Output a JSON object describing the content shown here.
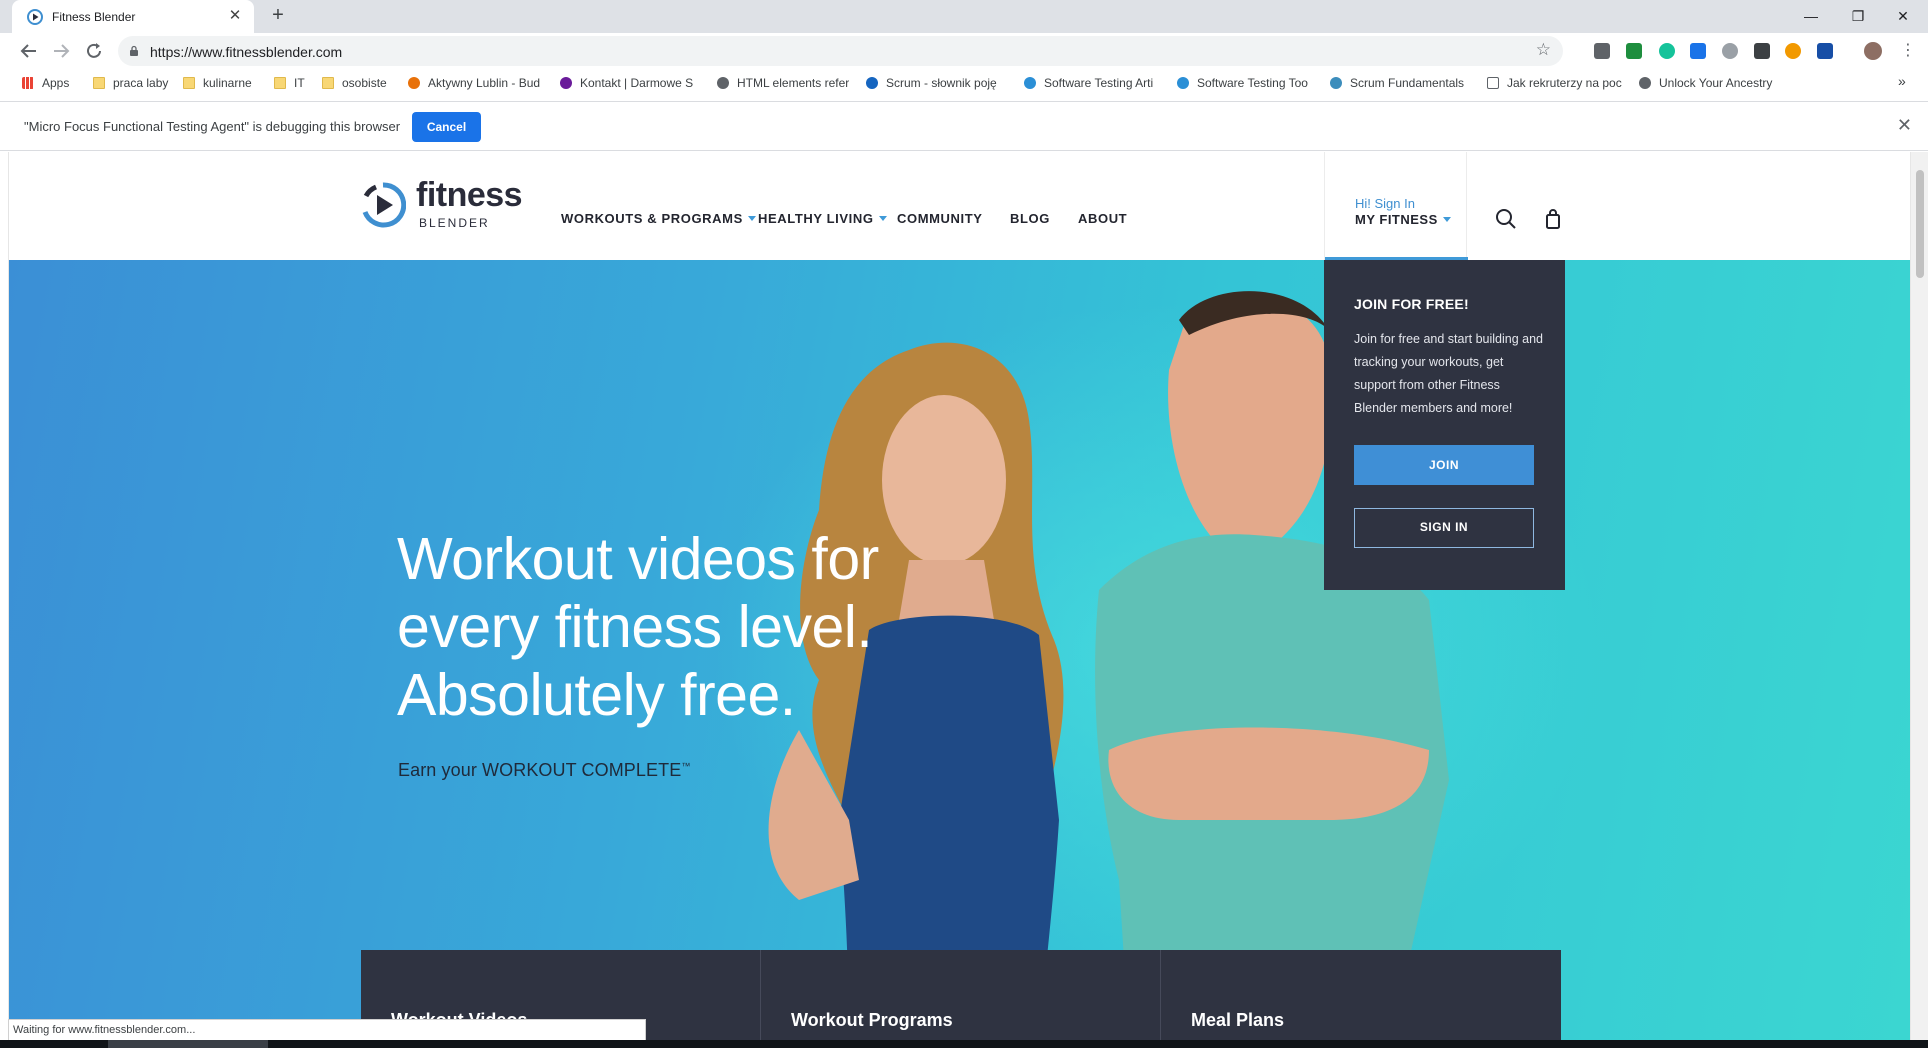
{
  "browser": {
    "tab": {
      "title": "Fitness Blender",
      "close": "✕"
    },
    "new_tab": "+",
    "window_controls": {
      "minimize": "—",
      "restore": "❐",
      "close": "✕"
    },
    "url": "https://www.fitnessblender.com",
    "bookmarks": [
      {
        "label": "Apps",
        "icon": "apps-grid-icon"
      },
      {
        "label": "praca laby",
        "icon": "folder-icon"
      },
      {
        "label": "kulinarne",
        "icon": "folder-icon"
      },
      {
        "label": "IT",
        "icon": "folder-icon"
      },
      {
        "label": "osobiste",
        "icon": "folder-icon"
      },
      {
        "label": "Aktywny Lublin - Bud",
        "icon": "site-icon"
      },
      {
        "label": "Kontakt | Darmowe S",
        "icon": "site-icon"
      },
      {
        "label": "HTML elements refer",
        "icon": "site-icon"
      },
      {
        "label": "Scrum - słownik poję",
        "icon": "site-icon"
      },
      {
        "label": "Software Testing Arti",
        "icon": "site-icon"
      },
      {
        "label": "Software Testing Too",
        "icon": "site-icon"
      },
      {
        "label": "Scrum Fundamentals",
        "icon": "site-icon"
      },
      {
        "label": "Jak rekruterzy na poc",
        "icon": "page-icon"
      },
      {
        "label": "Unlock Your Ancestry",
        "icon": "site-icon"
      }
    ],
    "bookmarks_overflow": "»",
    "infobar": {
      "message": "\"Micro Focus Functional Testing Agent\" is debugging this browser",
      "cancel_label": "Cancel",
      "close": "✕"
    },
    "status_text": "Waiting for www.fitnessblender.com...",
    "colors": {
      "tabstrip": "#dee1e6",
      "accent": "#1a73e8"
    }
  },
  "site": {
    "logo": {
      "word": "fitness",
      "sub": "BLENDER"
    },
    "nav": [
      {
        "label": "WORKOUTS & PROGRAMS",
        "has_dropdown": true
      },
      {
        "label": "HEALTHY LIVING",
        "has_dropdown": true
      },
      {
        "label": "COMMUNITY",
        "has_dropdown": false
      },
      {
        "label": "BLOG",
        "has_dropdown": false
      },
      {
        "label": "ABOUT",
        "has_dropdown": false
      }
    ],
    "account": {
      "greeting": "Hi! Sign In",
      "label": "MY FITNESS"
    },
    "dropdown": {
      "title": "JOIN FOR FREE!",
      "text": "Join for free and start building and tracking your workouts, get support from other Fitness Blender members and more!",
      "join_label": "JOIN",
      "signin_label": "SIGN IN"
    },
    "hero": {
      "headline": "Workout videos for every fitness level. Absolutely free.",
      "tagline": "Earn your WORKOUT COMPLETE",
      "tagline_mark": "™"
    },
    "cards": [
      {
        "title": "Workout Videos"
      },
      {
        "title": "Workout Programs"
      },
      {
        "title": "Meal Plans"
      }
    ],
    "colors": {
      "brand_blue": "#3f9ad8",
      "dark_panel": "#2f3341",
      "hero_start": "#3b8fd6",
      "hero_end": "#3bd6d1"
    }
  }
}
